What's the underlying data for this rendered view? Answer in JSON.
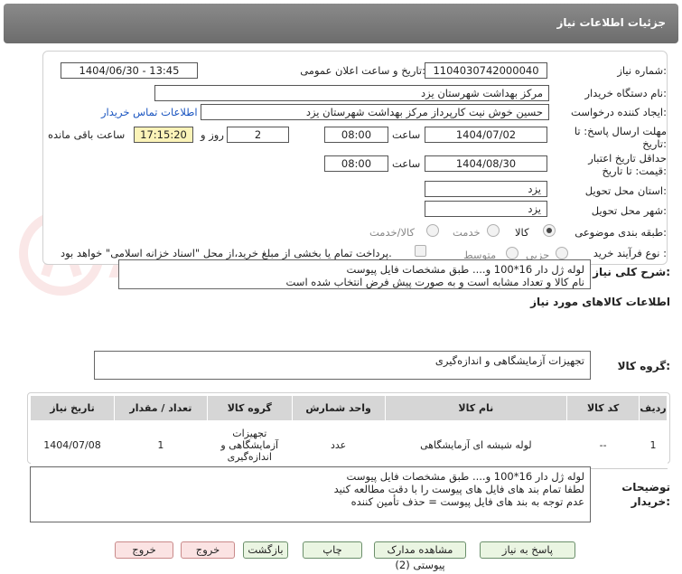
{
  "header": {
    "title": "جزئیات اطلاعات نیاز"
  },
  "form": {
    "need_number_label": "شماره نیاز:",
    "need_number": "1104030742000040",
    "announce_label": "تاریخ و ساعت اعلان عمومی:",
    "announce_value": "1404/06/30 - 13:45",
    "buyer_label": "نام دستگاه خریدار:",
    "buyer_value": "مرکز بهداشت شهرستان یزد",
    "creator_label": "ایجاد کننده درخواست:",
    "creator_value": "حسین خوش نیت کارپرداز مرکز بهداشت شهرستان یزد",
    "contact_link": "اطلاعات تماس خریدار",
    "deadline_label": "مهلت ارسال پاسخ: تا تاریخ:",
    "deadline_date": "1404/07/02",
    "time_label": "ساعت",
    "deadline_time": "08:00",
    "days_value": "2",
    "days_label": "روز و",
    "remaining_time": "17:15:20",
    "remaining_label": "ساعت باقی مانده",
    "validity_label": "حداقل تاریخ اعتبار قیمت: تا تاریخ:",
    "validity_date": "1404/08/30",
    "validity_time": "08:00",
    "province_label": "استان محل تحویل:",
    "province_value": "یزد",
    "city_label": "شهر محل تحویل:",
    "city_value": "یزد",
    "category_label": "طبقه بندی موضوعی:",
    "category_options": [
      "کالا",
      "خدمت",
      "کالا/خدمت"
    ],
    "category_selected": "کالا",
    "process_label": "نوع فرآیند خرید :",
    "process_options": [
      "جزیی",
      "متوسط"
    ],
    "payment_note": "پرداخت تمام یا بخشی از مبلغ خرید،از محل \"اسناد خزانه اسلامی\" خواهد بود."
  },
  "description": {
    "label": "شرح کلی نیاز:",
    "lines": [
      "لوله ژل دار 16*100 و.... طبق مشخصات فایل پیوست",
      "نام کالا و تعداد مشابه است و به صورت پیش فرض انتخاب شده است"
    ]
  },
  "goods_section_title": "اطلاعات کالاهای مورد نیاز",
  "goods_group": {
    "label": "گروه کالا:",
    "value": "تجهیزات آزمایشگاهی و اندازه‌گیری"
  },
  "table": {
    "headers": [
      "ردیف",
      "کد کالا",
      "نام کالا",
      "واحد شمارش",
      "گروه کالا",
      "تعداد / مقدار",
      "تاریخ نیاز"
    ],
    "rows": [
      [
        "1",
        "--",
        "لوله شیشه ای آزمایشگاهی",
        "عدد",
        "تجهیزات آزمایشگاهی و اندازه‌گیری",
        "1",
        "1404/07/08"
      ]
    ]
  },
  "buyer_notes": {
    "label": "توضیحات خریدار:",
    "lines": [
      "لوله ژل دار 16*100 و.... طبق مشخصات فایل پیوست",
      "لطفا تمام بند های فایل های پیوست را با دقت مطالعه کنید",
      "عدم توجه به بند های فایل پیوست = حذف تأمین کننده"
    ]
  },
  "buttons": {
    "reply": "پاسخ به نیاز",
    "attachments": "مشاهده مدارک پیوستی (2)",
    "print": "چاپ",
    "back": "بازگشت",
    "exit": "خروج"
  },
  "watermark_text": "AriaTender.net"
}
